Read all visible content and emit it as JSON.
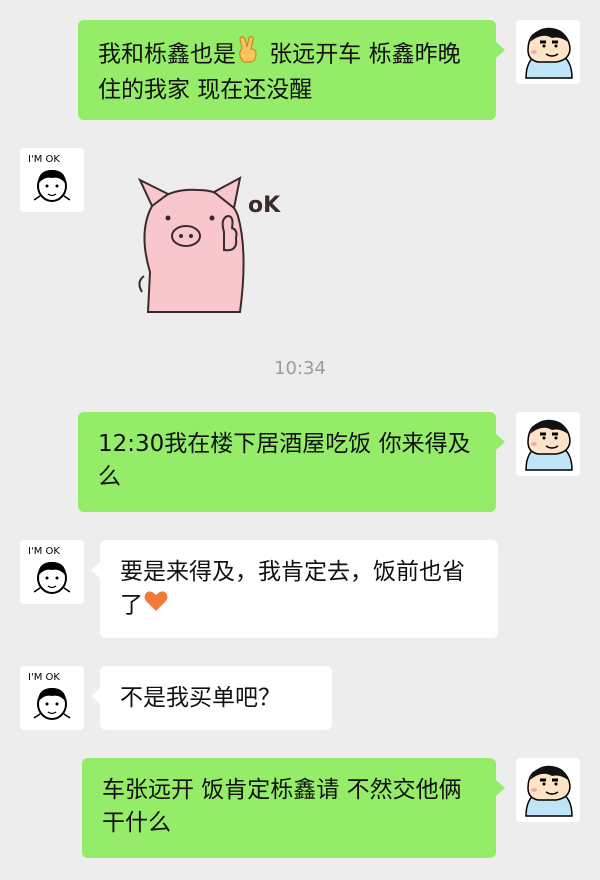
{
  "conversation": {
    "messages": [
      {
        "side": "me",
        "text_before": "我和栎鑫也是",
        "emoji": "victory-hand-icon",
        "text_after": " 张远开车 栎鑫昨晚住的我家 现在还没醒"
      },
      {
        "side": "them",
        "sticker": "pig-ok-sticker",
        "sticker_text": "oK"
      },
      {
        "side": "me",
        "text": "12:30我在楼下居酒屋吃饭 你来得及么"
      },
      {
        "side": "them",
        "text": "要是来得及，我肯定去，饭前也省了",
        "emoji": "orange-heart-icon"
      },
      {
        "side": "them",
        "text": "不是我买单吧？"
      },
      {
        "side": "me",
        "text": "车张远开 饭肯定栎鑫请 不然交他俩干什么"
      }
    ],
    "timestamp": "10:34",
    "their_avatar_caption": "I'M OK"
  },
  "colors": {
    "background": "#ededed",
    "my_bubble": "#95ec69",
    "their_bubble": "#ffffff",
    "heart": "#f07a3a",
    "pig": "#f7c7cd"
  }
}
